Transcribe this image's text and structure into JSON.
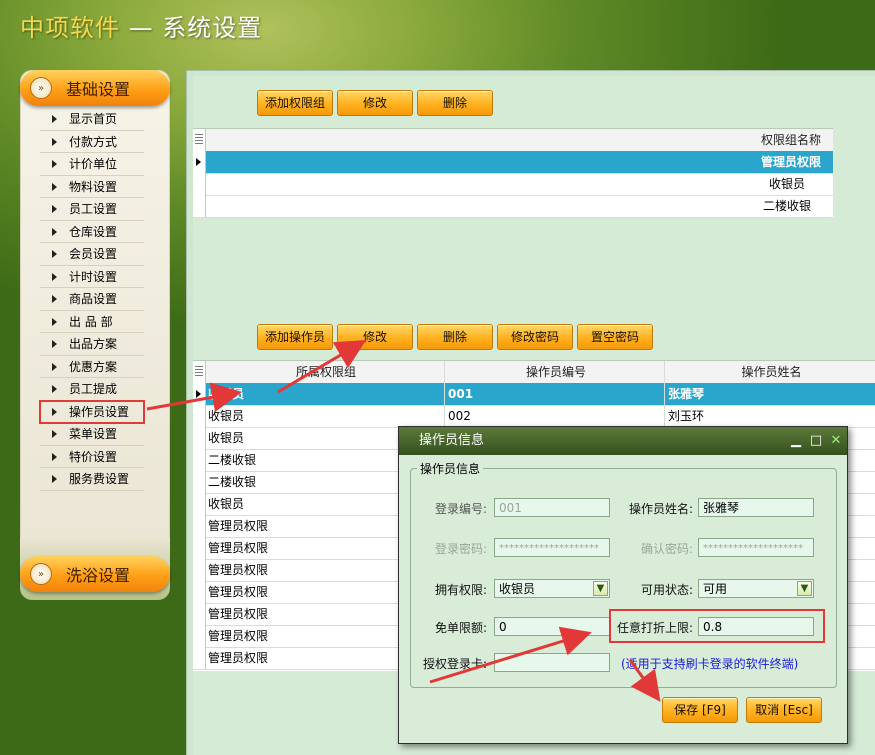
{
  "app": {
    "brand": "中项软件",
    "title_rest": " — 系统设置"
  },
  "sidebar": {
    "section_basic": "基础设置",
    "section_bath": "洗浴设置",
    "items": [
      {
        "label": "显示首页"
      },
      {
        "label": "付款方式"
      },
      {
        "label": "计价单位"
      },
      {
        "label": "物料设置"
      },
      {
        "label": "员工设置"
      },
      {
        "label": "仓库设置"
      },
      {
        "label": "会员设置"
      },
      {
        "label": "计时设置"
      },
      {
        "label": "商品设置"
      },
      {
        "label": "出 品 部"
      },
      {
        "label": "出品方案"
      },
      {
        "label": "优惠方案"
      },
      {
        "label": "员工提成"
      },
      {
        "label": "操作员设置"
      },
      {
        "label": "菜单设置"
      },
      {
        "label": "特价设置"
      },
      {
        "label": "服务费设置"
      }
    ]
  },
  "groups_toolbar": {
    "add": "添加权限组",
    "edit": "修改",
    "delete": "删除"
  },
  "groups_grid": {
    "header": "权限组名称",
    "rows": [
      {
        "name": "管理员权限"
      },
      {
        "name": "收银员"
      },
      {
        "name": "二楼收银"
      }
    ]
  },
  "ops_toolbar": {
    "add": "添加操作员",
    "edit": "修改",
    "delete": "删除",
    "change_pwd": "修改密码",
    "clear_pwd": "置空密码"
  },
  "ops_grid": {
    "headers": [
      "所属权限组",
      "操作员编号",
      "操作员姓名"
    ],
    "rows": [
      {
        "group": "收银员",
        "id": "001",
        "name": "张雅琴"
      },
      {
        "group": "收银员",
        "id": "002",
        "name": "刘玉环"
      },
      {
        "group": "收银员",
        "id": "",
        "name": ""
      },
      {
        "group": "二楼收银",
        "id": "",
        "name": ""
      },
      {
        "group": "二楼收银",
        "id": "",
        "name": ""
      },
      {
        "group": "收银员",
        "id": "",
        "name": ""
      },
      {
        "group": "管理员权限",
        "id": "",
        "name": ""
      },
      {
        "group": "管理员权限",
        "id": "",
        "name": ""
      },
      {
        "group": "管理员权限",
        "id": "",
        "name": ""
      },
      {
        "group": "管理员权限",
        "id": "",
        "name": ""
      },
      {
        "group": "管理员权限",
        "id": "",
        "name": ""
      },
      {
        "group": "管理员权限",
        "id": "",
        "name": ""
      },
      {
        "group": "管理员权限",
        "id": "",
        "name": ""
      }
    ]
  },
  "dialog": {
    "title": "操作员信息",
    "group_label": "操作员信息",
    "login_id_label": "登录编号:",
    "login_id_value": "001",
    "name_label": "操作员姓名:",
    "name_value": "张雅琴",
    "password_label": "登录密码:",
    "password_value": "********************",
    "confirm_label": "确认密码:",
    "confirm_value": "********************",
    "role_label": "拥有权限:",
    "role_value": "收银员",
    "status_label": "可用状态:",
    "status_value": "可用",
    "free_limit_label": "免单限额:",
    "free_limit_value": "0",
    "discount_label": "任意打折上限:",
    "discount_value": "0.8",
    "card_label": "授权登录卡:",
    "card_value": "",
    "card_hint": "(适用于支持刷卡登录的软件终端)",
    "save": "保存 [F9]",
    "cancel": "取消 [Esc]"
  },
  "colors": {
    "accent": "#ffb01e",
    "selection": "#2aa5cc",
    "annotation": "#e23838"
  },
  "icons": [
    "chevron-right-icon",
    "minimize-icon",
    "maximize-icon",
    "close-icon",
    "dropdown-arrow-icon",
    "row-indicator-icon"
  ]
}
